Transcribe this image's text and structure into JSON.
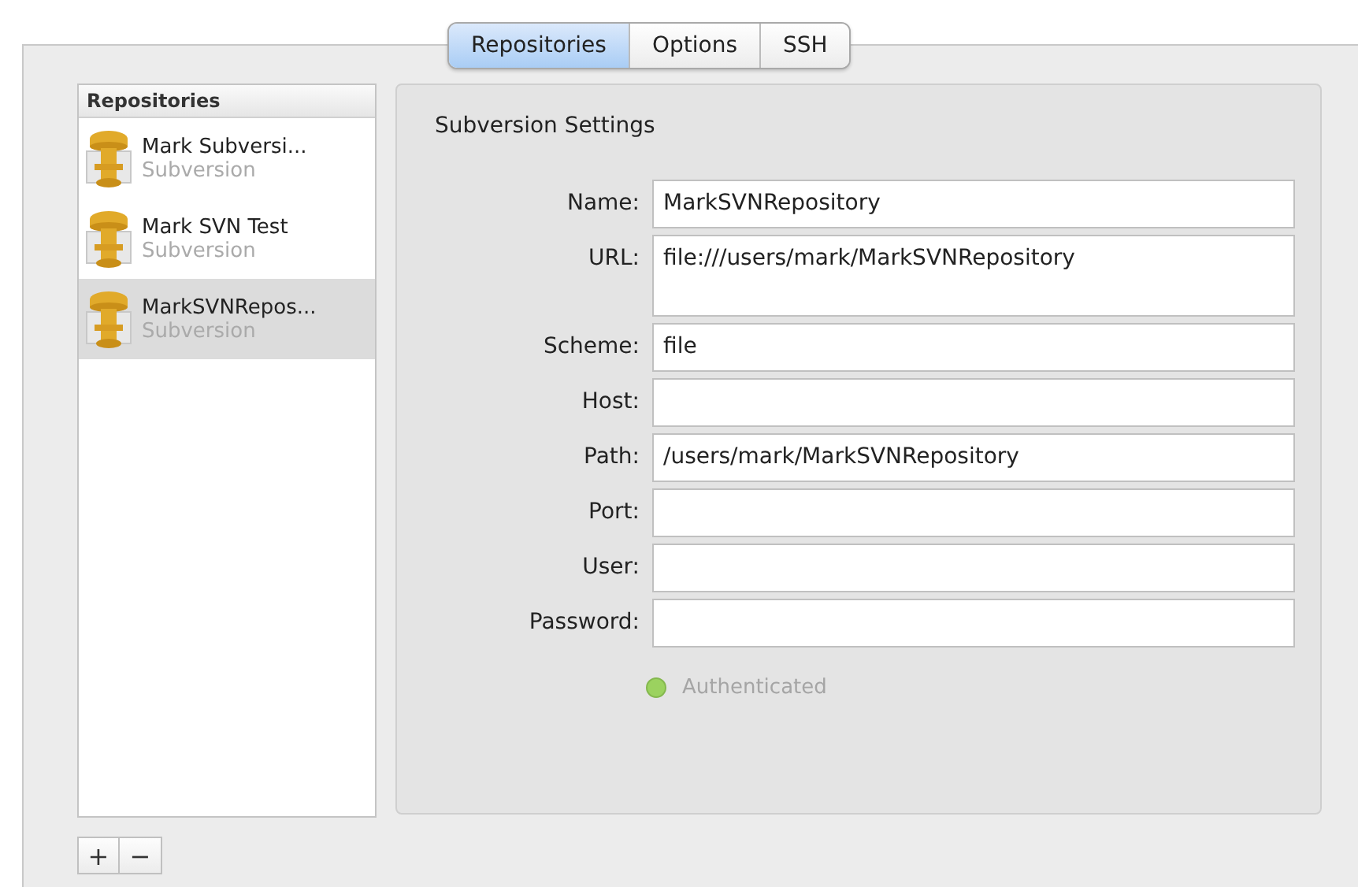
{
  "tabs": [
    {
      "label": "Repositories",
      "selected": true
    },
    {
      "label": "Options",
      "selected": false
    },
    {
      "label": "SSH",
      "selected": false
    }
  ],
  "sidebar": {
    "header": "Repositories",
    "items": [
      {
        "name": "Mark Subversi...",
        "type": "Subversion",
        "selected": false
      },
      {
        "name": "Mark SVN Test",
        "type": "Subversion",
        "selected": false
      },
      {
        "name": "MarkSVNRepos...",
        "type": "Subversion",
        "selected": true
      }
    ]
  },
  "settings": {
    "title": "Subversion Settings",
    "fields": [
      {
        "label": "Name:",
        "value": "MarkSVNRepository",
        "multiline": false
      },
      {
        "label": "URL:",
        "value": "file:///users/mark/MarkSVNRepository",
        "multiline": true
      },
      {
        "label": "Scheme:",
        "value": "file",
        "multiline": false
      },
      {
        "label": "Host:",
        "multiline": false
      },
      {
        "label": "Path:",
        "value": "/users/mark/MarkSVNRepository",
        "multiline": false
      },
      {
        "label": "Port:",
        "multiline": false
      },
      {
        "label": "User:",
        "multiline": false
      },
      {
        "label": "Password:",
        "multiline": false
      }
    ],
    "status": {
      "text": "Authenticated",
      "disabled": true
    }
  },
  "buttons": [
    "+",
    "−"
  ]
}
